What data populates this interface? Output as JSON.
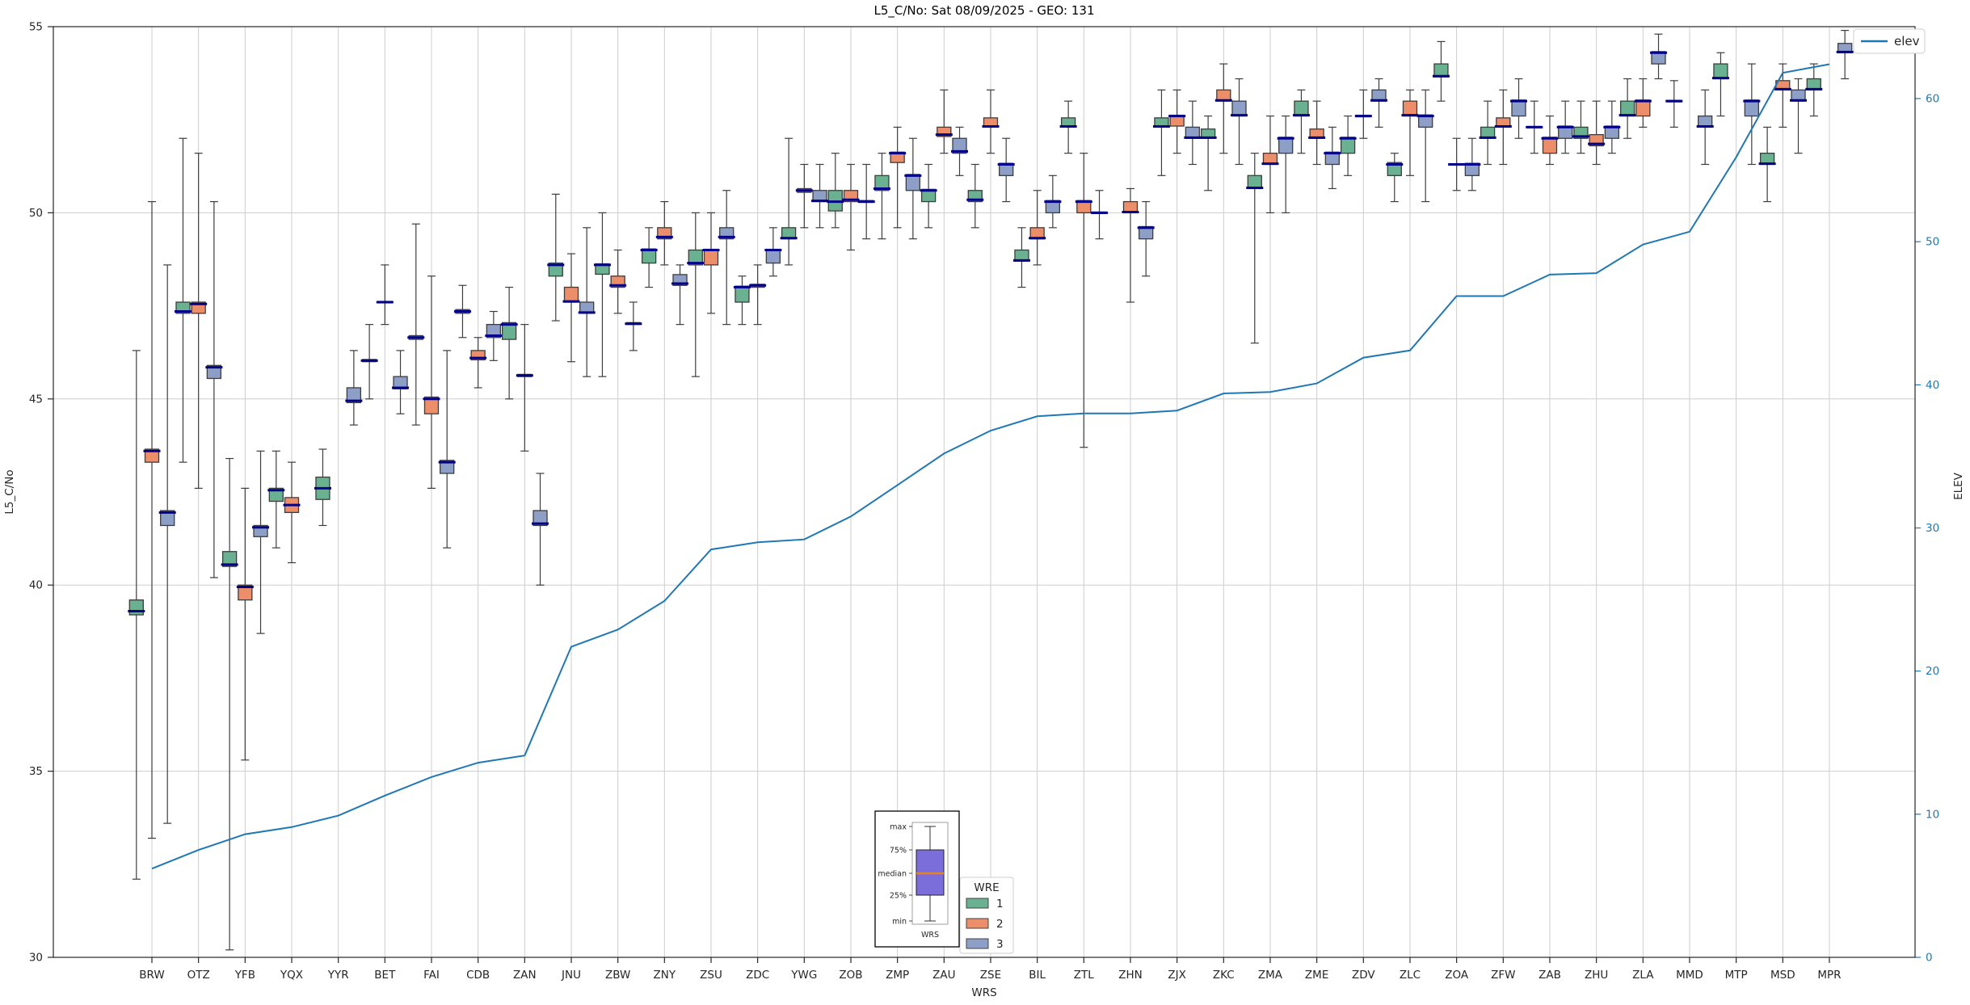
{
  "title": "L5_C/No: Sat 08/09/2025 - GEO: 131",
  "axes": {
    "left_label": "L5_C/No",
    "right_label": "ELEV",
    "x_label": "WRS",
    "left_ticks": [
      30,
      35,
      40,
      45,
      50,
      55
    ],
    "right_ticks": [
      0,
      10,
      20,
      30,
      40,
      50,
      60
    ],
    "left_tick_color": "#262626",
    "right_tick_color": "#1f77b4"
  },
  "legend_elev": {
    "label": "elev"
  },
  "legend_wre": {
    "title": "WRE",
    "entries": [
      {
        "label": "1",
        "color": "#69b190"
      },
      {
        "label": "2",
        "color": "#ec8e6a"
      },
      {
        "label": "3",
        "color": "#8d9fc7"
      }
    ]
  },
  "inset": {
    "labels": {
      "max": "max",
      "p75": "75%",
      "median": "median",
      "p25": "25%",
      "min": "min"
    },
    "xlabel": "WRS",
    "box_color": "#7b6edb",
    "median_color": "#e8821e"
  },
  "colors": {
    "grid": "#cdcdcd",
    "spine": "#262626",
    "box_edge": "#3d3d3d",
    "median": "#00008b",
    "elev_line": "#1f77b4",
    "whisker": "#3d3d3d"
  },
  "chart_data": {
    "type": "boxplot+line",
    "ylabel": "L5_C/No",
    "y2label": "ELEV",
    "xlabel": "WRS",
    "ylim": [
      30,
      55
    ],
    "y2lim": [
      0,
      65
    ],
    "grid": true,
    "categories": [
      "BRW",
      "OTZ",
      "YFB",
      "YQX",
      "YYR",
      "BET",
      "FAI",
      "CDB",
      "ZAN",
      "JNU",
      "ZBW",
      "ZNY",
      "ZSU",
      "ZDC",
      "YWG",
      "ZOB",
      "ZMP",
      "ZAU",
      "ZSE",
      "BIL",
      "ZTL",
      "ZHN",
      "ZJX",
      "ZKC",
      "ZMA",
      "ZME",
      "ZDV",
      "ZLC",
      "ZOA",
      "ZFW",
      "ZAB",
      "ZHU",
      "ZLA",
      "MMD",
      "MTP",
      "MSD",
      "MPR"
    ],
    "elev_series_name": "elev",
    "elev": [
      6.2,
      7.5,
      8.6,
      9.1,
      9.9,
      11.3,
      12.6,
      13.6,
      14.1,
      21.7,
      22.9,
      24.9,
      28.5,
      29.0,
      29.2,
      30.8,
      33.0,
      35.2,
      36.8,
      37.8,
      38.0,
      38.0,
      38.2,
      39.4,
      39.5,
      40.1,
      41.9,
      42.4,
      46.2,
      46.2,
      47.7,
      47.8,
      49.8,
      50.7,
      55.9,
      61.8,
      62.4
    ],
    "box_format": [
      "station",
      "wre",
      "whisker_low",
      "q1",
      "median",
      "q3",
      "whisker_high"
    ],
    "boxes": [
      [
        "BRW",
        1,
        32.1,
        39.2,
        39.3,
        39.6,
        46.3
      ],
      [
        "BRW",
        2,
        33.2,
        43.3,
        43.6,
        43.65,
        50.3
      ],
      [
        "BRW",
        3,
        33.6,
        41.6,
        41.95,
        42.0,
        48.6
      ],
      [
        "OTZ",
        1,
        43.3,
        47.3,
        47.35,
        47.6,
        52.0
      ],
      [
        "OTZ",
        2,
        42.6,
        47.3,
        47.55,
        47.6,
        51.6
      ],
      [
        "OTZ",
        3,
        40.2,
        45.55,
        45.85,
        45.9,
        50.3
      ],
      [
        "YFB",
        1,
        30.2,
        40.5,
        40.55,
        40.9,
        43.4
      ],
      [
        "YFB",
        2,
        35.3,
        39.6,
        39.95,
        40.0,
        42.6
      ],
      [
        "YFB",
        3,
        38.7,
        41.3,
        41.55,
        41.6,
        43.6
      ],
      [
        "YQX",
        1,
        41.0,
        42.25,
        42.55,
        42.6,
        43.6
      ],
      [
        "YQX",
        2,
        40.6,
        41.95,
        42.15,
        42.35,
        43.3
      ],
      [
        "YYR",
        1,
        41.6,
        42.3,
        42.6,
        42.9,
        43.65
      ],
      [
        "YYR",
        3,
        44.3,
        44.9,
        44.95,
        45.3,
        46.3
      ],
      [
        "BET",
        1,
        45.0,
        46.0,
        46.03,
        46.06,
        47.0
      ],
      [
        "BET",
        2,
        47.0,
        47.58,
        47.6,
        47.62,
        48.6
      ],
      [
        "BET",
        3,
        44.6,
        45.27,
        45.3,
        45.6,
        46.3
      ],
      [
        "FAI",
        1,
        44.3,
        46.6,
        46.65,
        46.7,
        49.7
      ],
      [
        "FAI",
        2,
        42.6,
        44.6,
        45.0,
        45.05,
        48.3
      ],
      [
        "FAI",
        3,
        41.0,
        43.0,
        43.3,
        43.35,
        46.3
      ],
      [
        "CDB",
        1,
        46.65,
        47.3,
        47.35,
        47.4,
        48.05
      ],
      [
        "CDB",
        2,
        45.3,
        46.05,
        46.1,
        46.3,
        46.65
      ],
      [
        "CDB",
        3,
        46.03,
        46.65,
        46.7,
        47.0,
        47.35
      ],
      [
        "ZAN",
        1,
        45.0,
        46.6,
        47.0,
        47.05,
        48.0
      ],
      [
        "ZAN",
        2,
        43.6,
        45.6,
        45.63,
        45.66,
        47.0
      ],
      [
        "ZAN",
        3,
        40.0,
        41.6,
        41.65,
        42.0,
        43.0
      ],
      [
        "JNU",
        1,
        47.1,
        48.3,
        48.6,
        48.65,
        50.5
      ],
      [
        "JNU",
        2,
        46.0,
        47.6,
        47.62,
        48.0,
        48.9
      ],
      [
        "JNU",
        3,
        45.6,
        47.3,
        47.32,
        47.6,
        49.6
      ],
      [
        "ZBW",
        1,
        45.6,
        48.35,
        48.6,
        48.63,
        50.0
      ],
      [
        "ZBW",
        2,
        47.3,
        48.0,
        48.05,
        48.3,
        49.0
      ],
      [
        "ZBW",
        3,
        46.3,
        47.0,
        47.02,
        47.05,
        47.6
      ],
      [
        "ZNY",
        1,
        48.0,
        48.65,
        49.0,
        49.03,
        49.6
      ],
      [
        "ZNY",
        2,
        48.6,
        49.3,
        49.35,
        49.6,
        50.3
      ],
      [
        "ZNY",
        3,
        47.0,
        48.05,
        48.1,
        48.34,
        48.6
      ],
      [
        "ZSU",
        1,
        45.6,
        48.6,
        48.65,
        49.0,
        50.0
      ],
      [
        "ZSU",
        2,
        47.3,
        48.6,
        49.0,
        49.02,
        50.0
      ],
      [
        "ZSU",
        3,
        47.0,
        49.3,
        49.35,
        49.6,
        50.6
      ],
      [
        "ZDC",
        1,
        47.0,
        47.6,
        48.0,
        48.03,
        48.3
      ],
      [
        "ZDC",
        2,
        47.0,
        48.0,
        48.05,
        48.08,
        48.6
      ],
      [
        "ZDC",
        3,
        48.3,
        48.65,
        49.0,
        49.02,
        49.6
      ],
      [
        "YWG",
        1,
        48.6,
        49.3,
        49.32,
        49.6,
        52.0
      ],
      [
        "YWG",
        2,
        49.6,
        50.55,
        50.6,
        50.65,
        51.3
      ],
      [
        "YWG",
        3,
        49.6,
        50.3,
        50.32,
        50.6,
        51.3
      ],
      [
        "ZOB",
        1,
        49.6,
        50.05,
        50.3,
        50.6,
        51.6
      ],
      [
        "ZOB",
        2,
        49.0,
        50.3,
        50.35,
        50.6,
        51.3
      ],
      [
        "ZOB",
        3,
        49.3,
        50.28,
        50.3,
        50.33,
        51.3
      ],
      [
        "ZMP",
        1,
        49.3,
        50.6,
        50.65,
        51.0,
        51.6
      ],
      [
        "ZMP",
        2,
        49.6,
        51.35,
        51.6,
        51.63,
        52.3
      ],
      [
        "ZMP",
        3,
        49.3,
        50.6,
        51.0,
        51.03,
        52.0
      ],
      [
        "ZAU",
        1,
        49.6,
        50.3,
        50.6,
        50.63,
        51.3
      ],
      [
        "ZAU",
        2,
        51.6,
        52.05,
        52.1,
        52.3,
        53.3
      ],
      [
        "ZAU",
        3,
        51.0,
        51.6,
        51.65,
        52.0,
        52.3
      ],
      [
        "ZSE",
        1,
        49.6,
        50.3,
        50.35,
        50.6,
        51.3
      ],
      [
        "ZSE",
        2,
        51.6,
        52.3,
        52.32,
        52.55,
        53.3
      ],
      [
        "ZSE",
        3,
        50.3,
        51.0,
        51.3,
        51.33,
        52.0
      ],
      [
        "BIL",
        1,
        48.0,
        48.7,
        48.72,
        49.0,
        49.6
      ],
      [
        "BIL",
        2,
        48.6,
        49.3,
        49.32,
        49.6,
        50.6
      ],
      [
        "BIL",
        3,
        49.6,
        50.0,
        50.3,
        50.33,
        51.0
      ],
      [
        "ZTL",
        1,
        51.6,
        52.3,
        52.32,
        52.55,
        53.0
      ],
      [
        "ZTL",
        2,
        43.7,
        50.0,
        50.3,
        50.33,
        51.6
      ],
      [
        "ZTL",
        3,
        49.3,
        49.98,
        50.0,
        50.02,
        50.6
      ],
      [
        "ZHN",
        2,
        47.6,
        50.0,
        50.02,
        50.3,
        50.65
      ],
      [
        "ZHN",
        3,
        48.3,
        49.3,
        49.6,
        49.63,
        50.3
      ],
      [
        "ZJX",
        1,
        51.0,
        52.3,
        52.32,
        52.55,
        53.3
      ],
      [
        "ZJX",
        2,
        51.6,
        52.33,
        52.6,
        52.62,
        53.3
      ],
      [
        "ZJX",
        3,
        51.3,
        52.0,
        52.02,
        52.3,
        53.0
      ],
      [
        "ZKC",
        1,
        50.6,
        52.0,
        52.02,
        52.25,
        52.6
      ],
      [
        "ZKC",
        2,
        51.6,
        53.0,
        53.02,
        53.3,
        54.0
      ],
      [
        "ZKC",
        3,
        51.3,
        52.6,
        52.62,
        53.0,
        53.6
      ],
      [
        "ZMA",
        1,
        46.5,
        50.65,
        50.67,
        51.0,
        51.6
      ],
      [
        "ZMA",
        2,
        50.0,
        51.3,
        51.32,
        51.6,
        52.6
      ],
      [
        "ZMA",
        3,
        50.0,
        51.6,
        52.0,
        52.03,
        52.6
      ],
      [
        "ZME",
        1,
        51.6,
        52.6,
        52.62,
        53.0,
        53.3
      ],
      [
        "ZME",
        2,
        51.3,
        52.0,
        52.02,
        52.25,
        53.0
      ],
      [
        "ZME",
        3,
        50.65,
        51.3,
        51.6,
        51.63,
        52.3
      ],
      [
        "ZDV",
        1,
        51.0,
        51.6,
        52.0,
        52.03,
        52.6
      ],
      [
        "ZDV",
        2,
        52.0,
        52.58,
        52.6,
        52.62,
        53.3
      ],
      [
        "ZDV",
        3,
        52.3,
        53.0,
        53.02,
        53.3,
        53.6
      ],
      [
        "ZLC",
        1,
        50.3,
        51.0,
        51.3,
        51.35,
        51.6
      ],
      [
        "ZLC",
        2,
        51.0,
        52.6,
        52.62,
        53.0,
        53.3
      ],
      [
        "ZLC",
        3,
        50.3,
        52.3,
        52.6,
        52.63,
        53.3
      ],
      [
        "ZOA",
        1,
        53.0,
        53.65,
        53.67,
        54.0,
        54.6
      ],
      [
        "ZOA",
        2,
        50.6,
        51.28,
        51.3,
        51.32,
        52.0
      ],
      [
        "ZOA",
        3,
        50.6,
        51.0,
        51.3,
        51.33,
        52.0
      ],
      [
        "ZFW",
        1,
        51.3,
        52.0,
        52.02,
        52.3,
        53.0
      ],
      [
        "ZFW",
        2,
        51.3,
        52.3,
        52.32,
        52.55,
        53.3
      ],
      [
        "ZFW",
        3,
        52.0,
        52.6,
        53.0,
        53.03,
        53.6
      ],
      [
        "ZAB",
        1,
        51.6,
        52.28,
        52.3,
        52.32,
        53.0
      ],
      [
        "ZAB",
        2,
        51.3,
        51.6,
        52.0,
        52.03,
        52.6
      ],
      [
        "ZAB",
        3,
        51.6,
        52.0,
        52.3,
        52.33,
        53.0
      ],
      [
        "ZHU",
        1,
        51.6,
        52.0,
        52.05,
        52.3,
        53.0
      ],
      [
        "ZHU",
        2,
        51.3,
        51.8,
        51.85,
        52.1,
        53.0
      ],
      [
        "ZHU",
        3,
        51.6,
        52.0,
        52.3,
        52.33,
        53.0
      ],
      [
        "ZLA",
        1,
        52.0,
        52.6,
        52.62,
        53.0,
        53.6
      ],
      [
        "ZLA",
        2,
        52.3,
        52.6,
        53.0,
        53.03,
        53.6
      ],
      [
        "ZLA",
        3,
        53.6,
        54.0,
        54.3,
        54.33,
        54.8
      ],
      [
        "MMD",
        1,
        52.3,
        52.98,
        53.0,
        53.02,
        53.55
      ],
      [
        "MMD",
        3,
        51.3,
        52.3,
        52.32,
        52.6,
        53.3
      ],
      [
        "MTP",
        1,
        52.6,
        53.6,
        53.62,
        54.0,
        54.3
      ],
      [
        "MTP",
        3,
        51.3,
        52.6,
        53.0,
        53.03,
        54.0
      ],
      [
        "MSD",
        1,
        50.3,
        51.3,
        51.32,
        51.6,
        52.3
      ],
      [
        "MSD",
        2,
        52.3,
        53.3,
        53.32,
        53.55,
        54.0
      ],
      [
        "MSD",
        3,
        51.6,
        53.0,
        53.02,
        53.3,
        53.6
      ],
      [
        "MPR",
        1,
        52.6,
        53.3,
        53.32,
        53.6,
        54.0
      ],
      [
        "MPR",
        3,
        53.6,
        54.3,
        54.32,
        54.55,
        54.9
      ]
    ]
  }
}
